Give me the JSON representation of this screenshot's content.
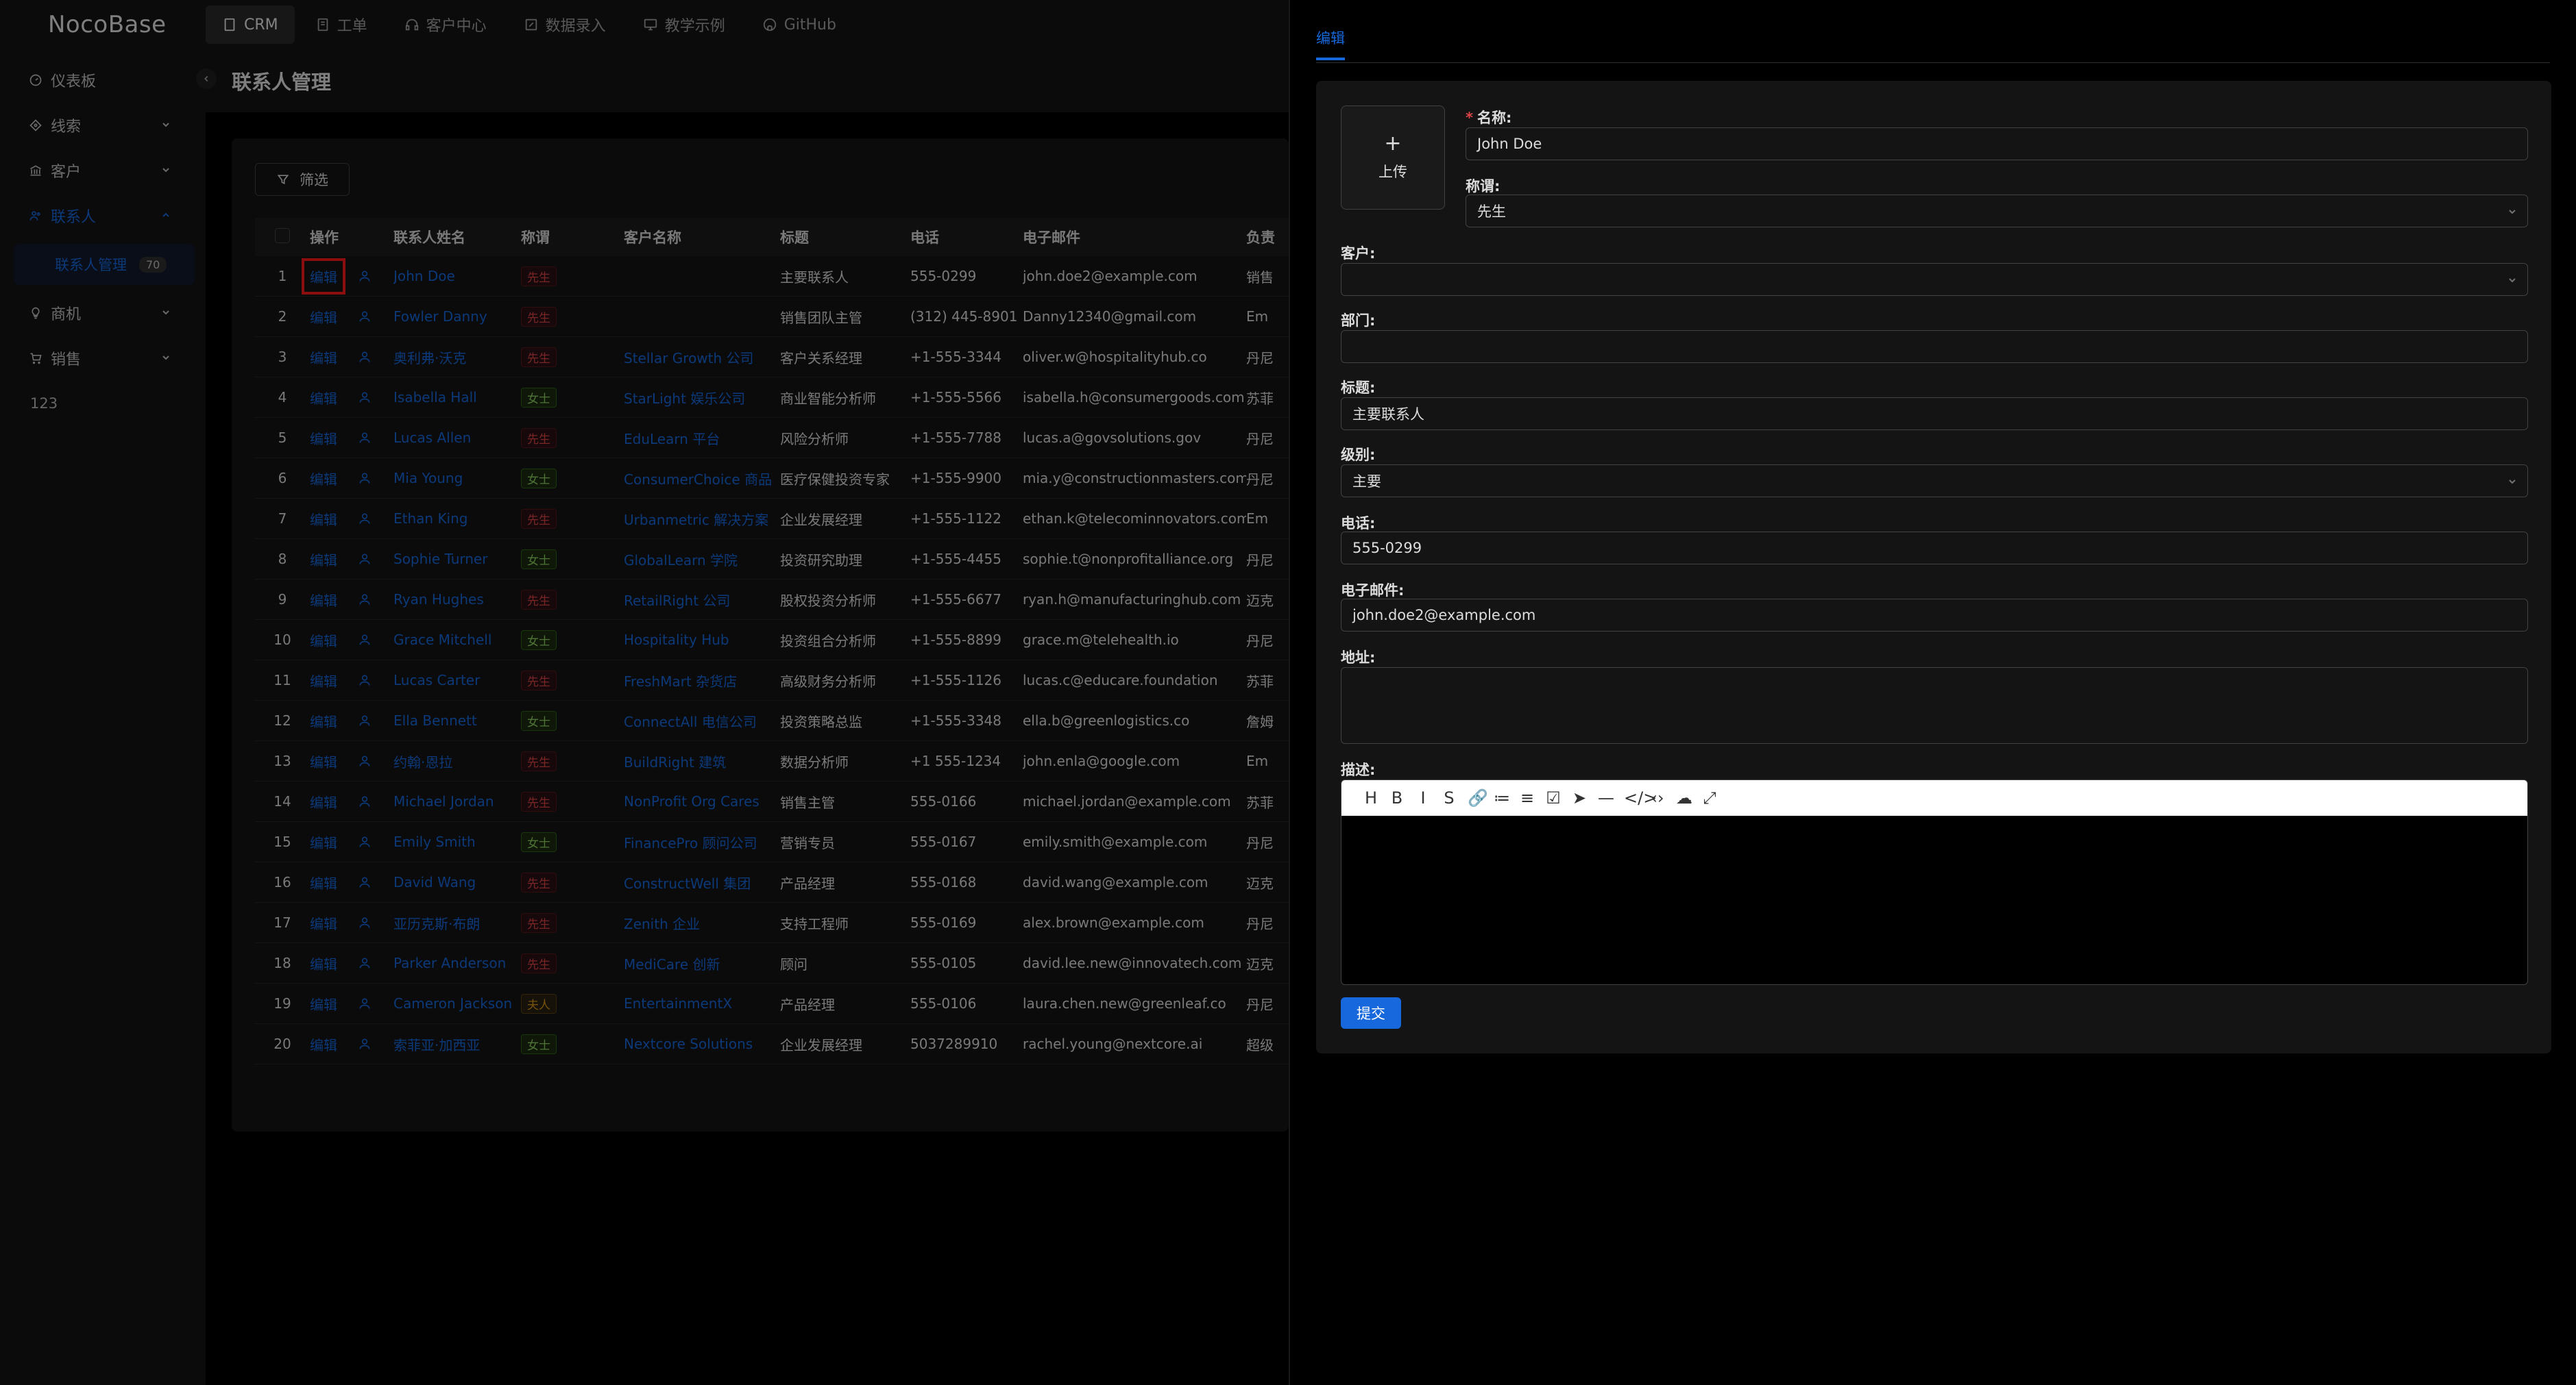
{
  "app": {
    "logo": "NocoBase"
  },
  "topnav": [
    {
      "label": "CRM",
      "icon": "page-icon",
      "active": true
    },
    {
      "label": "工单",
      "icon": "ticket-icon"
    },
    {
      "label": "客户中心",
      "icon": "headset-icon"
    },
    {
      "label": "数据录入",
      "icon": "edit-icon"
    },
    {
      "label": "教学示例",
      "icon": "desktop-icon"
    },
    {
      "label": "GitHub",
      "icon": "github-icon"
    }
  ],
  "sidebar": {
    "items": [
      {
        "label": "仪表板",
        "icon": "dashboard-icon"
      },
      {
        "label": "线索",
        "icon": "aim-icon"
      },
      {
        "label": "客户",
        "icon": "bank-icon"
      },
      {
        "label": "联系人",
        "icon": "team-icon"
      },
      {
        "label": "商机",
        "icon": "bulb-icon"
      },
      {
        "label": "销售",
        "icon": "cart-icon"
      }
    ],
    "sub_item": {
      "label": "联系人管理",
      "badge": "70"
    },
    "extra": "123"
  },
  "page": {
    "title": "联系人管理",
    "filter_label": "筛选"
  },
  "table": {
    "headers": [
      "操作",
      "联系人姓名",
      "称谓",
      "客户名称",
      "标题",
      "电话",
      "电子邮件",
      "负责"
    ],
    "edit_label": "编辑",
    "rows": [
      {
        "no": "1",
        "name": "John Doe",
        "title_tag": "先生",
        "tag_color": "red",
        "customer": "",
        "role": "主要联系人",
        "phone": "555-0299",
        "email": "john.doe2@example.com",
        "owner": "销售"
      },
      {
        "no": "2",
        "name": "Fowler Danny",
        "title_tag": "先生",
        "tag_color": "red",
        "customer": "",
        "role": "销售团队主管",
        "phone": "(312) 445-8901",
        "email": "Danny12340@gmail.com",
        "owner": "Em"
      },
      {
        "no": "3",
        "name": "奥利弗·沃克",
        "title_tag": "先生",
        "tag_color": "red",
        "customer": "Stellar Growth 公司",
        "role": "客户关系经理",
        "phone": "+1-555-3344",
        "email": "oliver.w@hospitalityhub.co",
        "owner": "丹尼"
      },
      {
        "no": "4",
        "name": "Isabella Hall",
        "title_tag": "女士",
        "tag_color": "green",
        "customer": "StarLight 娱乐公司",
        "role": "商业智能分析师",
        "phone": "+1-555-5566",
        "email": "isabella.h@consumergoods.com",
        "owner": "苏菲"
      },
      {
        "no": "5",
        "name": "Lucas Allen",
        "title_tag": "先生",
        "tag_color": "red",
        "customer": "EduLearn 平台",
        "role": "风险分析师",
        "phone": "+1-555-7788",
        "email": "lucas.a@govsolutions.gov",
        "owner": "丹尼"
      },
      {
        "no": "6",
        "name": "Mia Young",
        "title_tag": "女士",
        "tag_color": "green",
        "customer": "ConsumerChoice 商品",
        "role": "医疗保健投资专家",
        "phone": "+1-555-9900",
        "email": "mia.y@constructionmasters.com",
        "owner": "丹尼"
      },
      {
        "no": "7",
        "name": "Ethan King",
        "title_tag": "先生",
        "tag_color": "red",
        "customer": "Urbanmetric 解决方案",
        "role": "企业发展经理",
        "phone": "+1-555-1122",
        "email": "ethan.k@telecominnovators.com",
        "owner": "Em"
      },
      {
        "no": "8",
        "name": "Sophie Turner",
        "title_tag": "女士",
        "tag_color": "green",
        "customer": "GlobalLearn 学院",
        "role": "投资研究助理",
        "phone": "+1-555-4455",
        "email": "sophie.t@nonprofitalliance.org",
        "owner": "丹尼"
      },
      {
        "no": "9",
        "name": "Ryan Hughes",
        "title_tag": "先生",
        "tag_color": "red",
        "customer": "RetailRight 公司",
        "role": "股权投资分析师",
        "phone": "+1-555-6677",
        "email": "ryan.h@manufacturinghub.com",
        "owner": "迈克"
      },
      {
        "no": "10",
        "name": "Grace Mitchell",
        "title_tag": "女士",
        "tag_color": "green",
        "customer": "Hospitality Hub",
        "role": "投资组合分析师",
        "phone": "+1-555-8899",
        "email": "grace.m@telehealth.io",
        "owner": "丹尼"
      },
      {
        "no": "11",
        "name": "Lucas Carter",
        "title_tag": "先生",
        "tag_color": "red",
        "customer": "FreshMart 杂货店",
        "role": "高级财务分析师",
        "phone": "+1-555-1126",
        "email": "lucas.c@educare.foundation",
        "owner": "苏菲"
      },
      {
        "no": "12",
        "name": "Ella Bennett",
        "title_tag": "女士",
        "tag_color": "green",
        "customer": "ConnectAll 电信公司",
        "role": "投资策略总监",
        "phone": "+1-555-3348",
        "email": "ella.b@greenlogistics.co",
        "owner": "詹姆"
      },
      {
        "no": "13",
        "name": "约翰·恩拉",
        "title_tag": "先生",
        "tag_color": "red",
        "customer": "BuildRight 建筑",
        "role": "数据分析师",
        "phone": "+1 555-1234",
        "email": "john.enla@google.com",
        "owner": "Em"
      },
      {
        "no": "14",
        "name": "Michael Jordan",
        "title_tag": "先生",
        "tag_color": "red",
        "customer": "NonProfit Org Cares",
        "role": "销售主管",
        "phone": "555-0166",
        "email": "michael.jordan@example.com",
        "owner": "苏菲"
      },
      {
        "no": "15",
        "name": "Emily Smith",
        "title_tag": "女士",
        "tag_color": "green",
        "customer": "FinancePro 顾问公司",
        "role": "营销专员",
        "phone": "555-0167",
        "email": "emily.smith@example.com",
        "owner": "丹尼"
      },
      {
        "no": "16",
        "name": "David Wang",
        "title_tag": "先生",
        "tag_color": "red",
        "customer": "ConstructWell 集团",
        "role": "产品经理",
        "phone": "555-0168",
        "email": "david.wang@example.com",
        "owner": "迈克"
      },
      {
        "no": "17",
        "name": "亚历克斯·布朗",
        "title_tag": "先生",
        "tag_color": "red",
        "customer": "Zenith 企业",
        "role": "支持工程师",
        "phone": "555-0169",
        "email": "alex.brown@example.com",
        "owner": "丹尼"
      },
      {
        "no": "18",
        "name": "Parker Anderson",
        "title_tag": "先生",
        "tag_color": "red",
        "customer": "MediCare 创新",
        "role": "顾问",
        "phone": "555-0105",
        "email": "david.lee.new@innovatech.com",
        "owner": "迈克"
      },
      {
        "no": "19",
        "name": "Cameron Jackson",
        "title_tag": "夫人",
        "tag_color": "gold",
        "customer": "EntertainmentX",
        "role": "产品经理",
        "phone": "555-0106",
        "email": "laura.chen.new@greenleaf.co",
        "owner": "丹尼"
      },
      {
        "no": "20",
        "name": "索菲亚·加西亚",
        "title_tag": "女士",
        "tag_color": "green",
        "customer": "Nextcore Solutions",
        "role": "企业发展经理",
        "phone": "5037289910",
        "email": "rachel.young@nextcore.ai",
        "owner": "超级"
      }
    ]
  },
  "drawer": {
    "tab": "编辑",
    "upload_label": "上传",
    "fields": {
      "name": {
        "label": "名称:",
        "value": "John Doe"
      },
      "salutation": {
        "label": "称谓:",
        "value": "先生"
      },
      "customer": {
        "label": "客户:",
        "value": ""
      },
      "department": {
        "label": "部门:",
        "value": ""
      },
      "title": {
        "label": "标题:",
        "value": "主要联系人"
      },
      "level": {
        "label": "级别:",
        "value": "主要"
      },
      "phone": {
        "label": "电话:",
        "value": "555-0299"
      },
      "email": {
        "label": "电子邮件:",
        "value": "john.doe2@example.com"
      },
      "address": {
        "label": "地址:",
        "value": ""
      },
      "description": {
        "label": "描述:",
        "value": ""
      }
    },
    "editor_tools": [
      "H",
      "B",
      "I",
      "S",
      "🔗",
      "≔",
      "≡",
      "☑",
      "➤",
      "—",
      "</>",
      "‹›",
      "☁",
      "⤢"
    ],
    "submit_label": "提交"
  }
}
